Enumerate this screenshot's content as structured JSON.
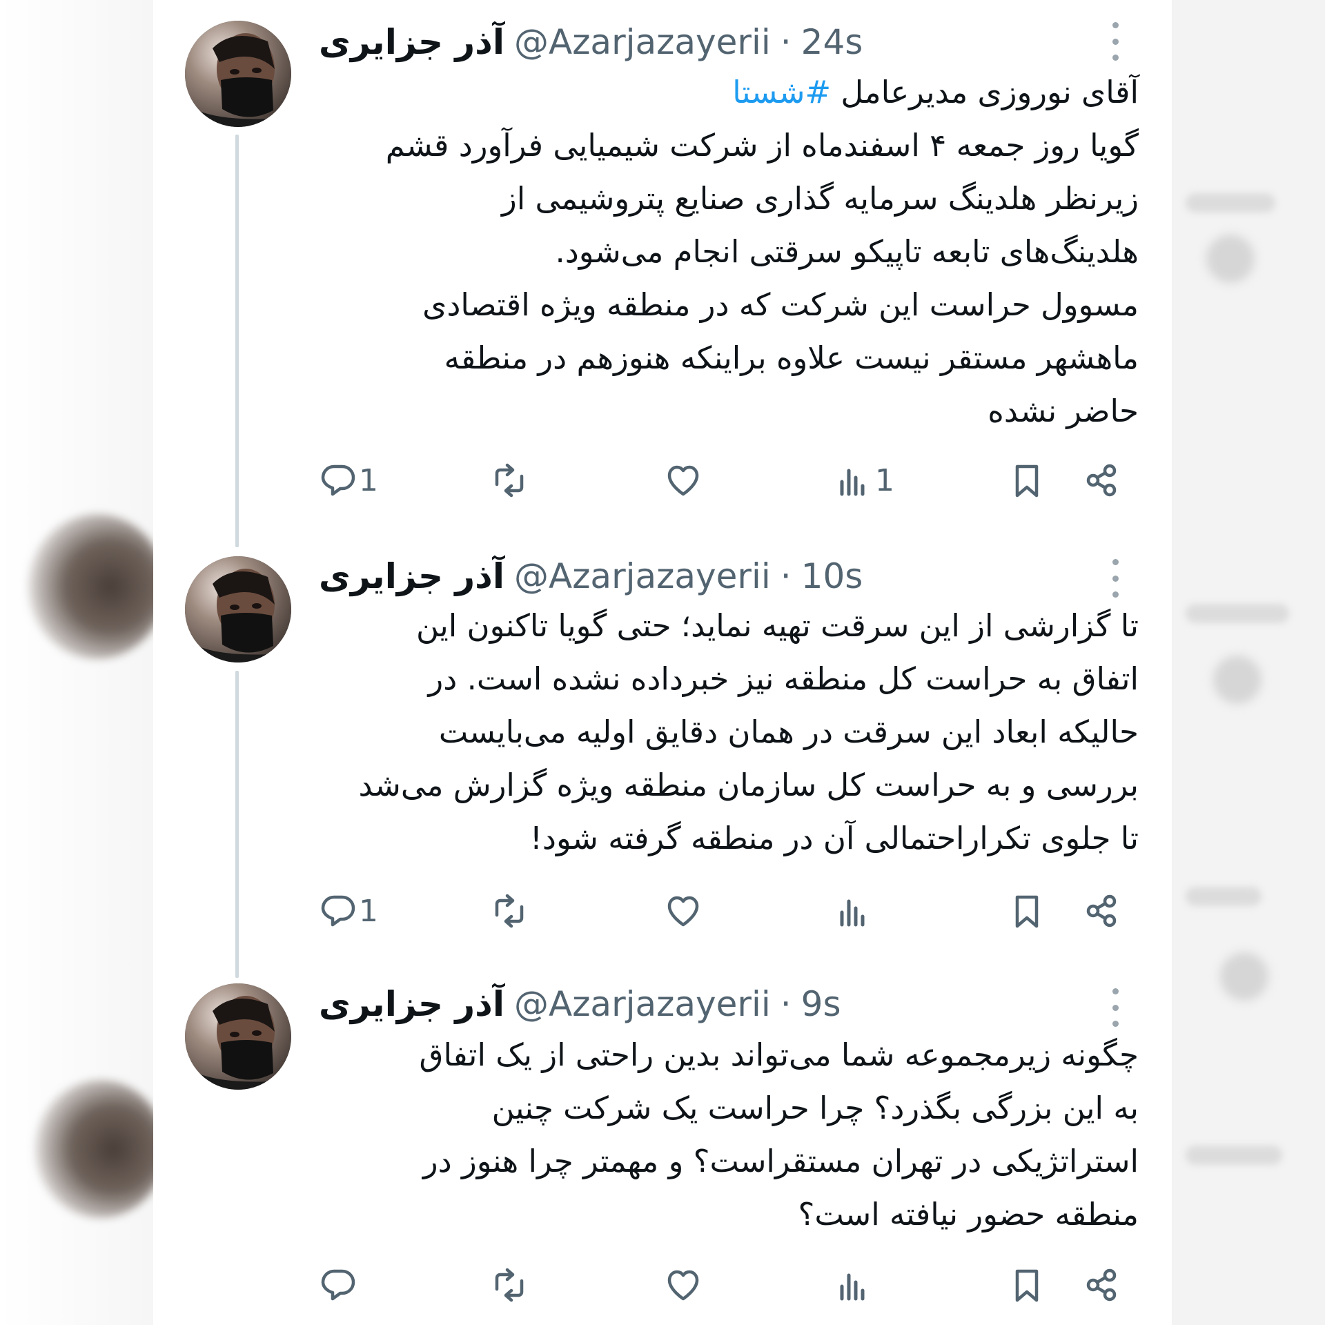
{
  "tweets": [
    {
      "display_name": "آذر جزایری",
      "handle": "@Azarjazayerii",
      "separator": "·",
      "time": "24s",
      "lines": [
        {
          "text": "آقای نوروزی مدیرعامل ",
          "hashtag": "#شستا"
        },
        {
          "text": "گویا روز جمعه ۴ اسفندماه از شرکت شیمیایی فرآورد قشم"
        },
        {
          "text": "زیرنظر هلدینگ سرمایه گذاری صنایع پتروشیمی از"
        },
        {
          "text": "هلدینگ‌های تابعه تاپیکو سرقتی انجام می‌شود."
        },
        {
          "text": "مسوول حراست این شرکت که در منطقه ویژه اقتصادی"
        },
        {
          "text": "ماهشهر مستقر نیست علاوه براینکه هنوزهم در منطقه"
        },
        {
          "text": "حاضر نشده"
        }
      ],
      "actions": {
        "reply_count": "1",
        "retweet_count": "",
        "like_count": "",
        "views_count": "1"
      }
    },
    {
      "display_name": "آذر جزایری",
      "handle": "@Azarjazayerii",
      "separator": "·",
      "time": "10s",
      "lines": [
        {
          "text": "تا گزارشی از این سرقت تهیه نماید؛ حتی گویا تاکنون این"
        },
        {
          "text": "اتفاق به حراست کل منطقه نیز خبرداده نشده است. در"
        },
        {
          "text": "حالیکه ابعاد این سرقت در همان دقایق اولیه می‌بایست"
        },
        {
          "text": "بررسی و به حراست کل سازمان منطقه ویژه گزارش می‌شد"
        },
        {
          "text": "تا جلوی تکراراحتمالی آن در منطقه گرفته شود!"
        }
      ],
      "actions": {
        "reply_count": "1",
        "retweet_count": "",
        "like_count": "",
        "views_count": ""
      }
    },
    {
      "display_name": "آذر جزایری",
      "handle": "@Azarjazayerii",
      "separator": "·",
      "time": "9s",
      "lines": [
        {
          "text": "چگونه زیرمجموعه شما می‌تواند بدین راحتی از یک اتفاق"
        },
        {
          "text": "به این بزرگی بگذرد؟ چرا حراست یک شرکت چنین"
        },
        {
          "text": "استراتژیکی در تهران مستقراست؟ و مهمتر چرا هنوز در"
        },
        {
          "text": "منطقه حضور نیافته است؟"
        }
      ],
      "actions": {
        "reply_count": "",
        "retweet_count": "",
        "like_count": "",
        "views_count": ""
      }
    }
  ],
  "icons": [
    "reply-icon",
    "retweet-icon",
    "like-icon",
    "views-icon",
    "bookmark-icon",
    "share-icon",
    "more-icon"
  ],
  "colors": {
    "hashtag": "#1d9bf0",
    "icon": "#536471",
    "thread_line": "#cfd9de"
  }
}
